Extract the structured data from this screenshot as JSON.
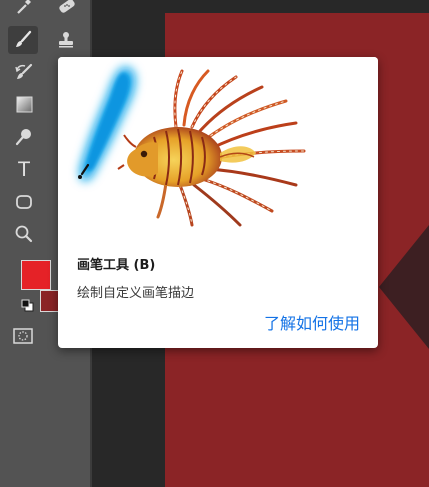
{
  "toolbar": {
    "tools": [
      {
        "name": "eyedropper-tool",
        "icon": "eyedropper-icon"
      },
      {
        "name": "healing-brush-tool",
        "icon": "bandage-icon"
      },
      {
        "name": "brush-tool",
        "icon": "brush-icon",
        "selected": true
      },
      {
        "name": "clone-stamp-tool",
        "icon": "stamp-icon"
      },
      {
        "name": "history-brush-tool",
        "icon": "history-brush-icon"
      },
      {
        "name": "gradient-tool",
        "icon": "gradient-icon"
      },
      {
        "name": "dodge-tool",
        "icon": "dodge-icon"
      },
      {
        "name": "type-tool",
        "icon": "type-icon"
      },
      {
        "name": "shape-tool",
        "icon": "rounded-rectangle-icon"
      },
      {
        "name": "zoom-tool",
        "icon": "magnifier-icon"
      }
    ],
    "type_glyph": "T"
  },
  "colors": {
    "foreground": "#e52227",
    "background": "#8b2426",
    "canvas": "#8b2426",
    "accent_link": "#1473e6",
    "brush_stroke": "#0aa3e8"
  },
  "tooltip": {
    "title": "画笔工具 (B)",
    "description": "绘制自定义画笔描边",
    "learn_more_link": "了解如何使用"
  }
}
